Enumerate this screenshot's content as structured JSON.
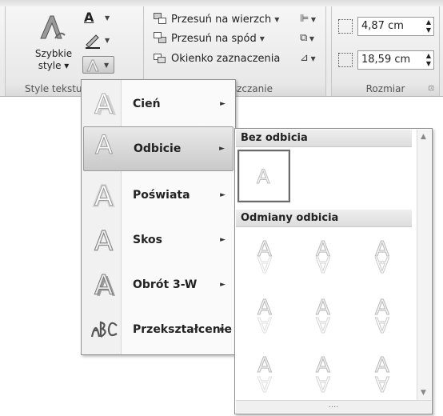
{
  "ribbon": {
    "styles_group": {
      "quick_styles_label_line1": "Szybkie",
      "quick_styles_label_line2": "style ▾",
      "group_label": "Style tekstu WordArt"
    },
    "arrange_group": {
      "bring_forward": "Przesuń na wierzch",
      "send_backward": "Przesuń na spód",
      "selection_pane": "Okienko zaznaczenia",
      "group_label": "Rozmieszczanie"
    },
    "size_group": {
      "height_value": "4,87 cm",
      "width_value": "18,59 cm",
      "group_label": "Rozmiar"
    }
  },
  "effects_menu": {
    "items": [
      {
        "label": "Cień",
        "icon": "shadow-a-icon"
      },
      {
        "label": "Odbicie",
        "icon": "reflection-a-icon",
        "active": true
      },
      {
        "label": "Poświata",
        "icon": "glow-a-icon"
      },
      {
        "label": "Skos",
        "icon": "bevel-a-icon"
      },
      {
        "label": "Obrót 3-W",
        "icon": "rotation-3d-a-icon"
      },
      {
        "label": "Przekształcenie",
        "icon": "transform-abc-icon"
      }
    ]
  },
  "reflection_submenu": {
    "no_reflection_header": "Bez odbicia",
    "variations_header": "Odmiany odbicia",
    "grip": "....",
    "thumbnail_letter": "A"
  }
}
